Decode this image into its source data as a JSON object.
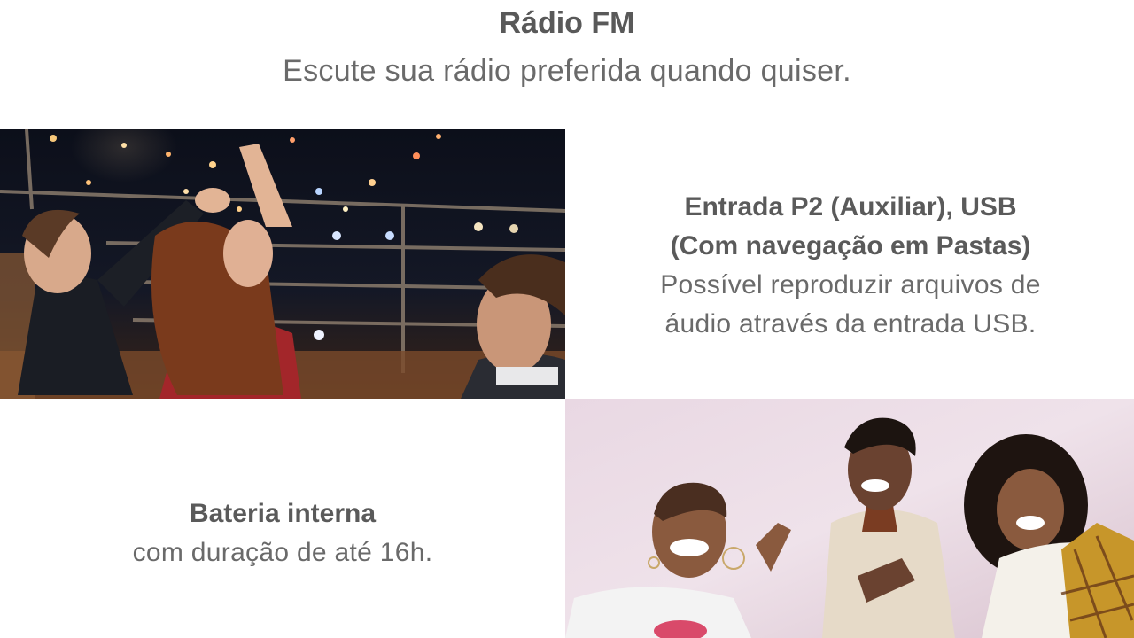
{
  "header": {
    "title": "Rádio FM",
    "subtitle": "Escute sua rádio preferida quando quiser."
  },
  "features": {
    "usb": {
      "title_line1": "Entrada P2 (Auxiliar), USB",
      "title_line2": "(Com navegação em Pastas)",
      "desc_line1": "Possível reproduzir arquivos de",
      "desc_line2": "áudio através da entrada USB."
    },
    "battery": {
      "title": "Bateria interna",
      "desc": "com duração de até 16h."
    }
  },
  "images": {
    "night_party": "photo-people-dancing-rooftop-night",
    "day_party": "photo-friends-laughing-outdoors"
  }
}
